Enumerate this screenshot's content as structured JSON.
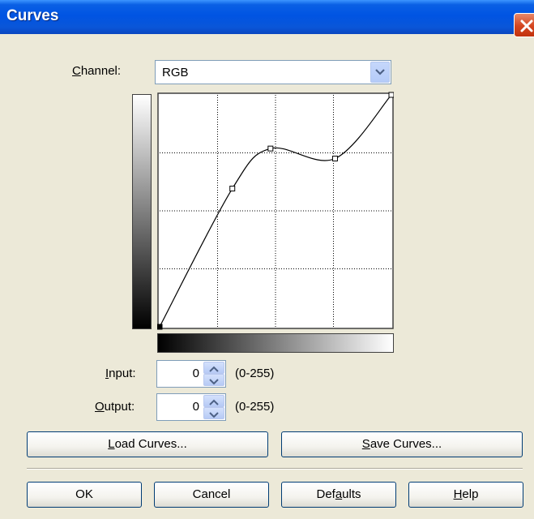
{
  "window": {
    "title": "Curves"
  },
  "channel": {
    "label": "Channel:",
    "value": "RGB"
  },
  "input": {
    "label": "Input:",
    "value": "0",
    "range": "(0-255)"
  },
  "output": {
    "label": "Output:",
    "value": "0",
    "range": "(0-255)"
  },
  "buttons": {
    "load_curves": "Load Curves...",
    "save_curves": "Save Curves...",
    "ok": "OK",
    "cancel": "Cancel",
    "defaults": "Defaults",
    "help": "Help"
  },
  "curve": {
    "input_range": [
      0,
      255
    ],
    "output_range": [
      0,
      255
    ],
    "control_points": [
      [
        0,
        0
      ],
      [
        80,
        152
      ],
      [
        122,
        196
      ],
      [
        193,
        185
      ],
      [
        255,
        255
      ]
    ]
  },
  "colors": {
    "title_bar": "#0054e3",
    "close_button": "#d4451f",
    "dialog_bg": "#ece9d8"
  }
}
